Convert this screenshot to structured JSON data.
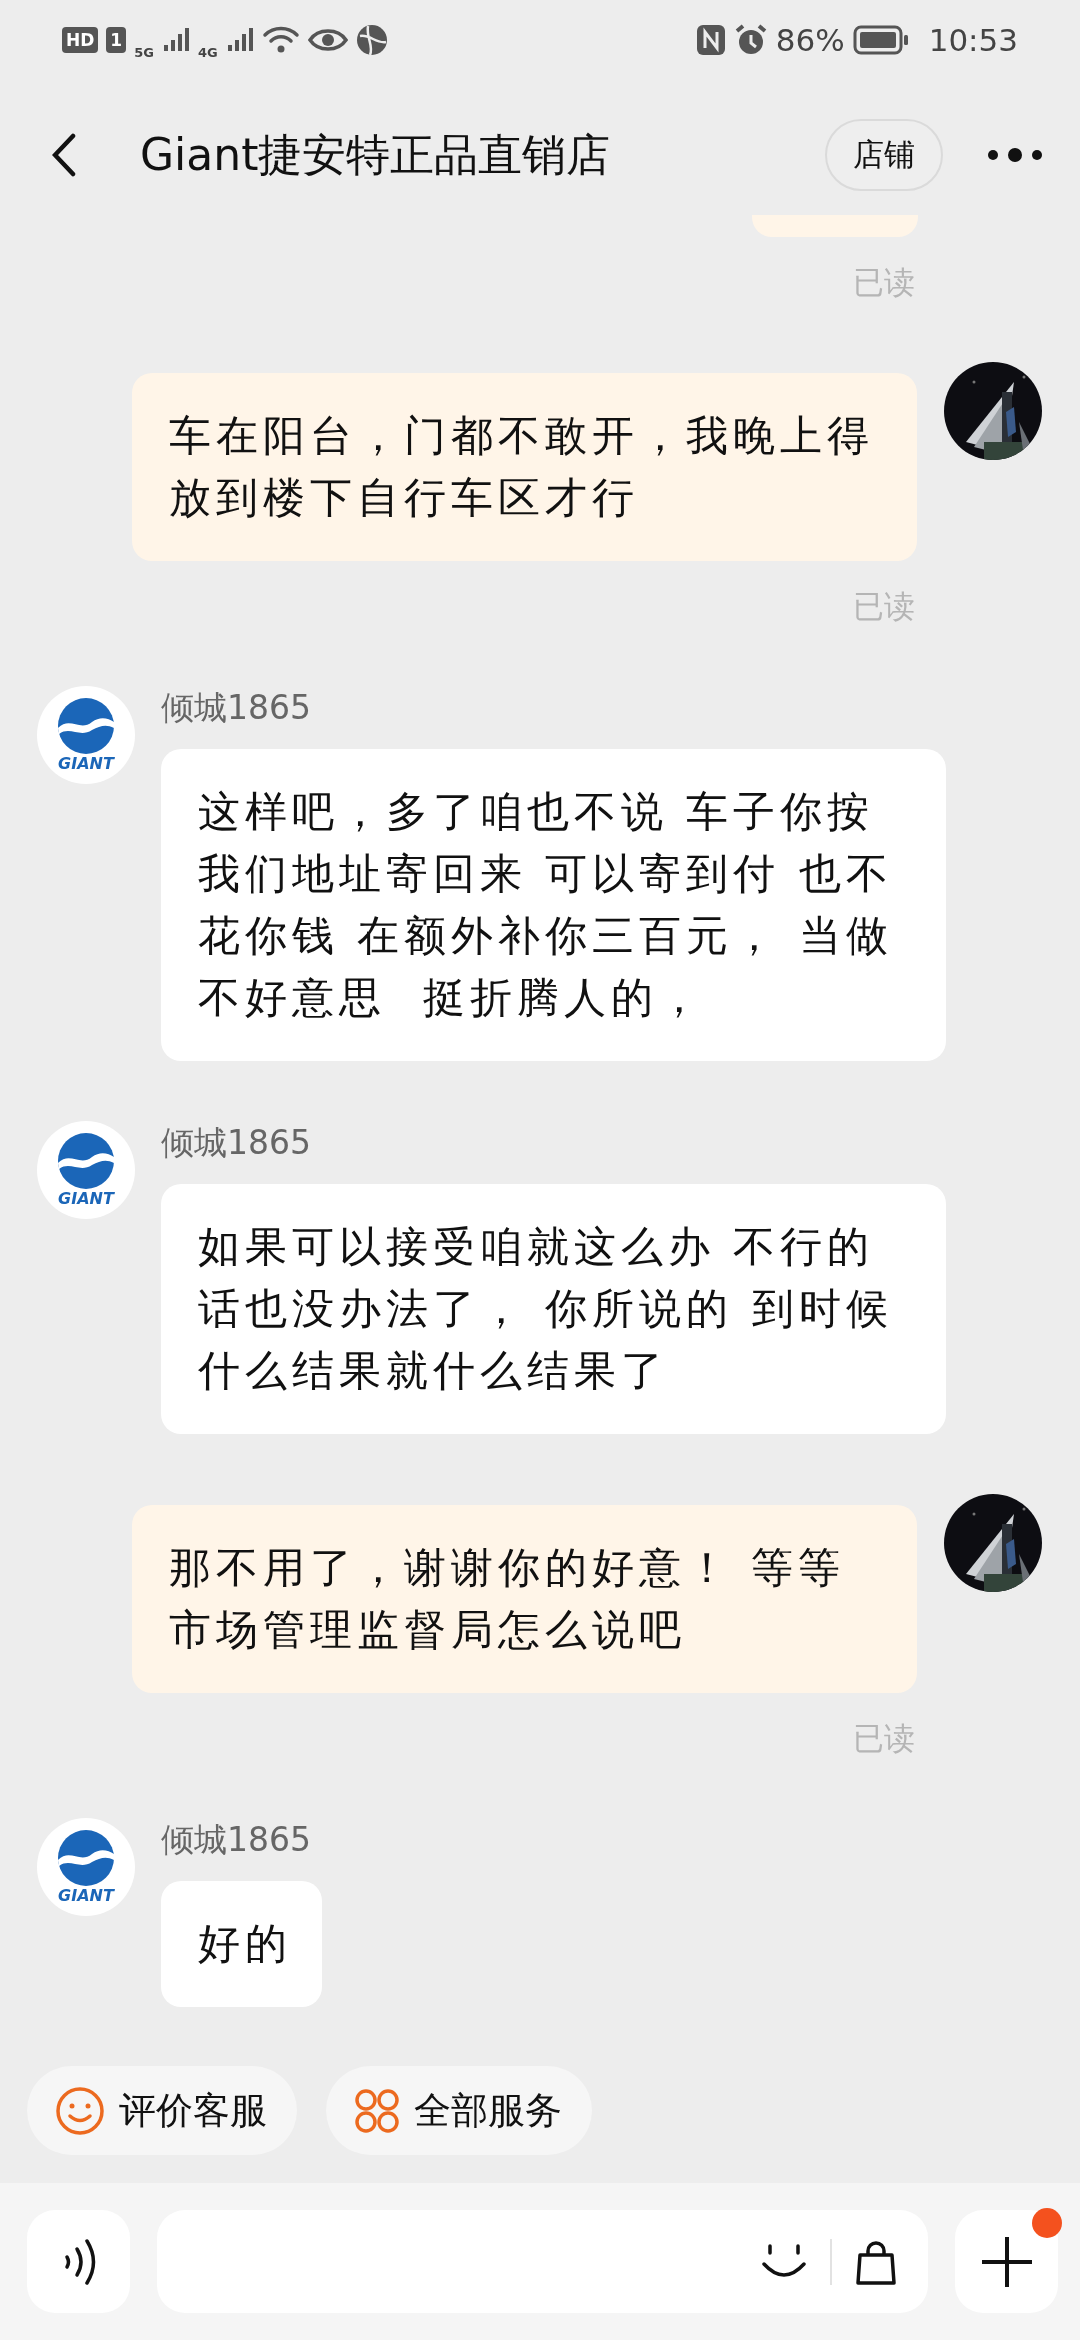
{
  "status_bar": {
    "hd_label": "HD",
    "sim_label": "1",
    "network_1": "5G",
    "network_2": "4G",
    "battery": "86%",
    "time": "10:53"
  },
  "header": {
    "title": "Giant捷安特正品直销店",
    "shop_button": "店铺"
  },
  "messages": [
    {
      "kind": "clipped",
      "read_label": "已读"
    },
    {
      "kind": "sent",
      "text": "车在阳台，门都不敢开，我晚上得放到楼下自行车区才行",
      "read_label": "已读"
    },
    {
      "kind": "received",
      "sender": "倾城1865",
      "avatar_label": "GIANT",
      "text": "这样吧，多了咱也不说 车子你按我们地址寄回来 可以寄到付 也不花你钱 在额外补你三百元， 当做不好意思  挺折腾人的，"
    },
    {
      "kind": "received",
      "sender": "倾城1865",
      "avatar_label": "GIANT",
      "text": "如果可以接受咱就这么办 不行的话也没办法了， 你所说的 到时候什么结果就什么结果了"
    },
    {
      "kind": "sent",
      "text": "那不用了，谢谢你的好意！ 等等市场管理监督局怎么说吧",
      "read_label": "已读"
    },
    {
      "kind": "received",
      "sender": "倾城1865",
      "avatar_label": "GIANT",
      "text": "好的"
    }
  ],
  "service_chips": [
    {
      "kind": "rate",
      "label": "评价客服"
    },
    {
      "kind": "services",
      "label": "全部服务"
    }
  ],
  "input_bar": {
    "has_notification": true
  }
}
